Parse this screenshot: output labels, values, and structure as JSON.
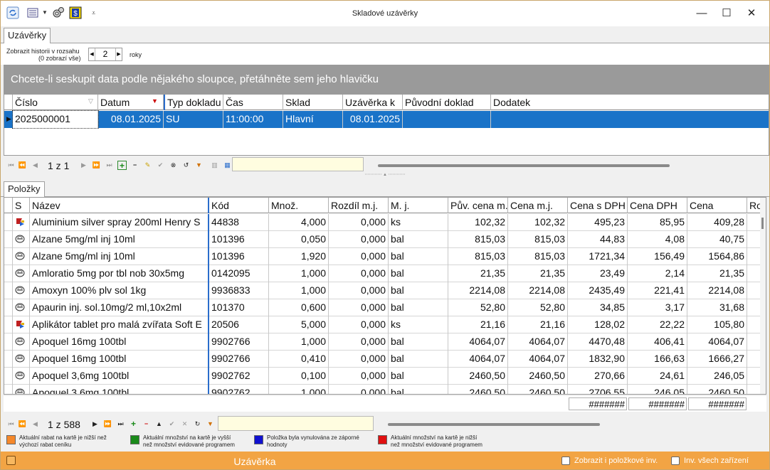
{
  "window": {
    "title": "Skladové uzávěrky",
    "minimize": "—",
    "maximize": "☐",
    "close": "✕"
  },
  "top_tab": "Uzávěrky",
  "history": {
    "label_line1": "Zobrazit historii v rozsahu",
    "label_line2": "(0 zobrazí vše)",
    "value": "2",
    "unit": "roky"
  },
  "group_panel": "Chcete-li seskupit data podle nějakého sloupce, přetáhněte sem jeho hlavičku",
  "top_grid": {
    "columns": [
      "Číslo",
      "Datum",
      "Typ dokladu",
      "Čas",
      "Sklad",
      "Uzávěrka k",
      "Původní doklad",
      "Dodatek"
    ],
    "rows": [
      [
        "2025000001",
        "08.01.2025",
        "SU",
        "11:00:00",
        "Hlavní",
        "08.01.2025",
        "",
        ""
      ]
    ]
  },
  "top_nav": {
    "page": "1 z 1"
  },
  "bottom_tab": "Položky",
  "items_grid": {
    "columns": [
      "S",
      "Název",
      "Kód",
      "Množ.",
      "Rozdíl m.j.",
      "M. j.",
      "Pův. cena m.j.",
      "Cena m.j.",
      "Cena s DPH",
      "Cena DPH",
      "Cena",
      "Ro"
    ],
    "rows": [
      [
        "flag",
        "Aluminium silver spray 200ml Henry S",
        "44838",
        "4,000",
        "0,000",
        "ks",
        "102,32",
        "102,32",
        "495,23",
        "85,95",
        "409,28"
      ],
      [
        "pill",
        "Alzane 5mg/ml inj 10ml",
        "101396",
        "0,050",
        "0,000",
        "bal",
        "815,03",
        "815,03",
        "44,83",
        "4,08",
        "40,75"
      ],
      [
        "pill",
        "Alzane 5mg/ml inj 10ml",
        "101396",
        "1,920",
        "0,000",
        "bal",
        "815,03",
        "815,03",
        "1721,34",
        "156,49",
        "1564,86"
      ],
      [
        "pill",
        "Amloratio 5mg por tbl nob 30x5mg",
        "0142095",
        "1,000",
        "0,000",
        "bal",
        "21,35",
        "21,35",
        "23,49",
        "2,14",
        "21,35"
      ],
      [
        "pill",
        "Amoxyn 100% plv sol 1kg",
        "9936833",
        "1,000",
        "0,000",
        "bal",
        "2214,08",
        "2214,08",
        "2435,49",
        "221,41",
        "2214,08"
      ],
      [
        "pill",
        "Apaurin inj. sol.10mg/2 ml,10x2ml",
        "101370",
        "0,600",
        "0,000",
        "bal",
        "52,80",
        "52,80",
        "34,85",
        "3,17",
        "31,68"
      ],
      [
        "flag",
        "Aplikátor tablet pro malá zvířata Soft E",
        "20506",
        "5,000",
        "0,000",
        "ks",
        "21,16",
        "21,16",
        "128,02",
        "22,22",
        "105,80"
      ],
      [
        "pill",
        "Apoquel 16mg 100tbl",
        "9902766",
        "1,000",
        "0,000",
        "bal",
        "4064,07",
        "4064,07",
        "4470,48",
        "406,41",
        "4064,07"
      ],
      [
        "pill",
        "Apoquel 16mg 100tbl",
        "9902766",
        "0,410",
        "0,000",
        "bal",
        "4064,07",
        "4064,07",
        "1832,90",
        "166,63",
        "1666,27"
      ],
      [
        "pill",
        "Apoquel 3,6mg 100tbl",
        "9902762",
        "0,100",
        "0,000",
        "bal",
        "2460,50",
        "2460,50",
        "270,66",
        "24,61",
        "246,05"
      ],
      [
        "pill",
        "Apoquel 3,6mg 100tbl",
        "9902762",
        "1,000",
        "0,000",
        "bal",
        "2460,50",
        "2460,50",
        "2706,55",
        "246,05",
        "2460,50"
      ]
    ],
    "summary": [
      "#######",
      "#######",
      "#######"
    ]
  },
  "bottom_nav": {
    "page": "1 z 588"
  },
  "legend": [
    {
      "color": "#f5882a",
      "line1": "Aktuální rabat na kartě je nižší než",
      "line2": "výchozí rabat ceníku"
    },
    {
      "color": "#1a8a1a",
      "line1": "Aktuální množství na kartě je vyšší",
      "line2": "než množství evidované programem"
    },
    {
      "color": "#1010d0",
      "line1": "Položka byla vynulována ze záporné",
      "line2": "hodnoty"
    },
    {
      "color": "#e01010",
      "line1": "Aktuální množství na kartě je nižší",
      "line2": "než množství evidované programem"
    }
  ],
  "footer": {
    "button": "Uzávěrka",
    "check1": "Zobrazit i položkové inv.",
    "check2": "Inv. všech zařízení"
  }
}
